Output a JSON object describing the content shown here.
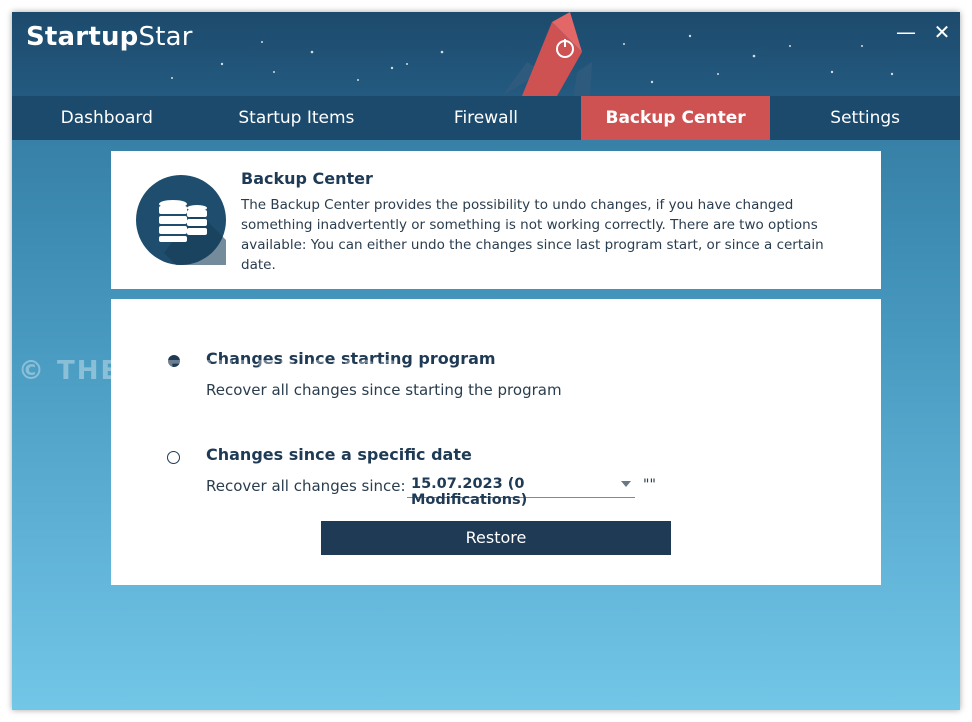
{
  "app": {
    "title_bold": "Startup",
    "title_light": "Star"
  },
  "window_controls": {
    "minimize": "—",
    "close": "✕"
  },
  "nav": {
    "tabs": [
      {
        "label": "Dashboard",
        "active": false
      },
      {
        "label": "Startup Items",
        "active": false
      },
      {
        "label": "Firewall",
        "active": false
      },
      {
        "label": "Backup Center",
        "active": true
      },
      {
        "label": "Settings",
        "active": false
      }
    ]
  },
  "info": {
    "title": "Backup Center",
    "text": "The Backup Center provides the possibility to undo changes, if you have changed something inadvertently or something is not working correctly. There are two options available: You can either undo the changes since last program start, or since a certain date.",
    "icon": "database-icon"
  },
  "options": {
    "since_start": {
      "title": "Changes since starting program",
      "description": "Recover all changes since starting the program",
      "selected": true
    },
    "since_date": {
      "title": "Changes since a specific date",
      "description": "Recover all changes since:",
      "selected_value": "15.07.2023 (0 Modifications)",
      "trailing": "\"\"",
      "selected": false
    },
    "restore_label": "Restore"
  },
  "watermark": "© THESOFTWARE.SHOP",
  "colors": {
    "accent": "#cf5253",
    "navy": "#1e3a55",
    "header": "#1c4a6c"
  }
}
